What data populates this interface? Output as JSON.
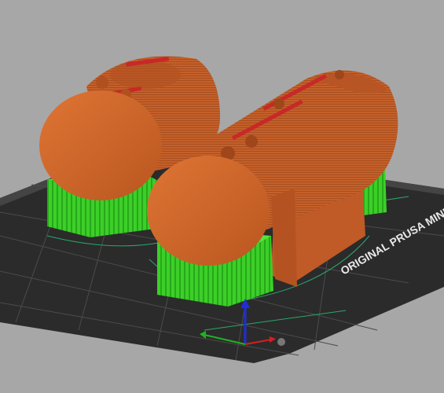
{
  "viewport": {
    "background": "#a7a7a7",
    "bed_label": "ORIGINAL PRUSA MINI",
    "bed_color": "#2f2f2f",
    "grid_color": "#4a4a4a",
    "model_color": "#c8632a",
    "model_highlight": "#e07a3a",
    "support_color": "#3fd12a",
    "seam_color": "#c72828"
  },
  "scene": {
    "objects": [
      {
        "name": "tank-left",
        "type": "horizontal-cylinder",
        "supports": "green-cradle"
      },
      {
        "name": "tank-right",
        "type": "horizontal-cylinder",
        "supports": "green-cradle"
      }
    ]
  },
  "axes": {
    "icons": [
      "x-axis-arrow-icon",
      "y-axis-arrow-icon",
      "z-axis-arrow-icon"
    ],
    "colors": {
      "x": "#d02020",
      "y": "#20b020",
      "z": "#2030d0"
    }
  }
}
